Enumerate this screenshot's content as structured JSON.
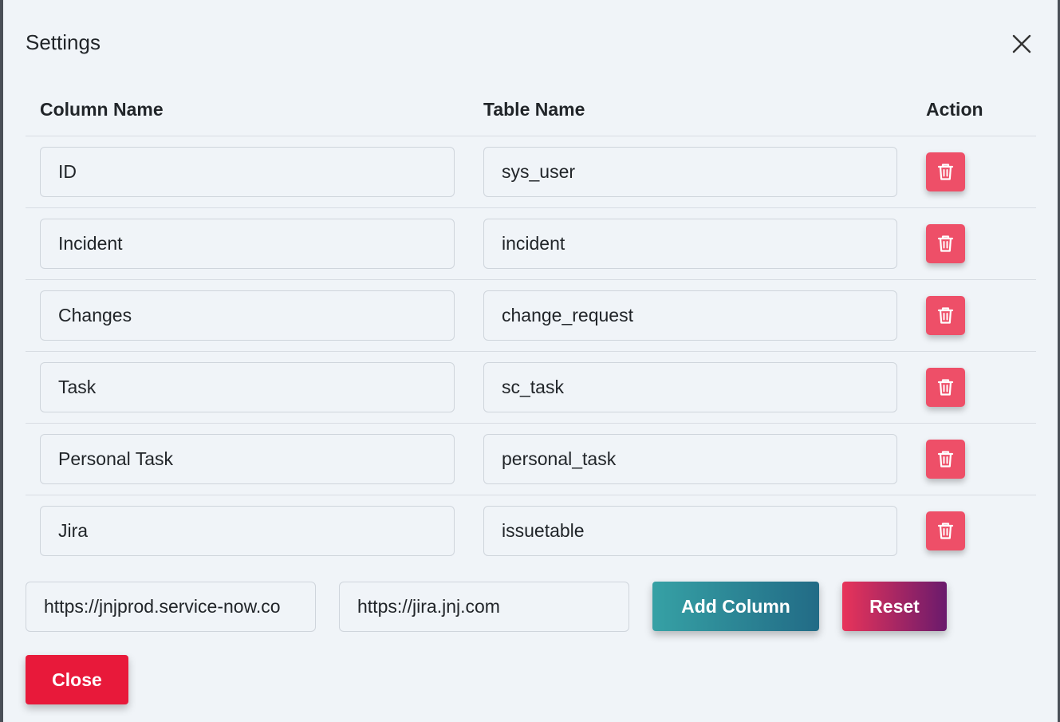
{
  "modal": {
    "title": "Settings"
  },
  "table": {
    "headers": {
      "column_name": "Column Name",
      "table_name": "Table Name",
      "action": "Action"
    },
    "rows": [
      {
        "column": "ID",
        "table": "sys_user"
      },
      {
        "column": "Incident",
        "table": "incident"
      },
      {
        "column": "Changes",
        "table": "change_request"
      },
      {
        "column": "Task",
        "table": "sc_task"
      },
      {
        "column": "Personal Task",
        "table": "personal_task"
      },
      {
        "column": "Jira",
        "table": "issuetable"
      }
    ]
  },
  "urls": {
    "servicenow": "https://jnjprod.service-now.co",
    "jira": "https://jira.jnj.com"
  },
  "buttons": {
    "add_column": "Add Column",
    "reset": "Reset",
    "close": "Close"
  },
  "icons": {
    "delete": "trash-icon",
    "close": "close-icon"
  },
  "colors": {
    "delete": "#ee4f68",
    "add_column_start": "#36a1a5",
    "add_column_end": "#226b86",
    "reset_start": "#e8345a",
    "reset_end": "#6a1a6c",
    "close": "#e8193a"
  }
}
